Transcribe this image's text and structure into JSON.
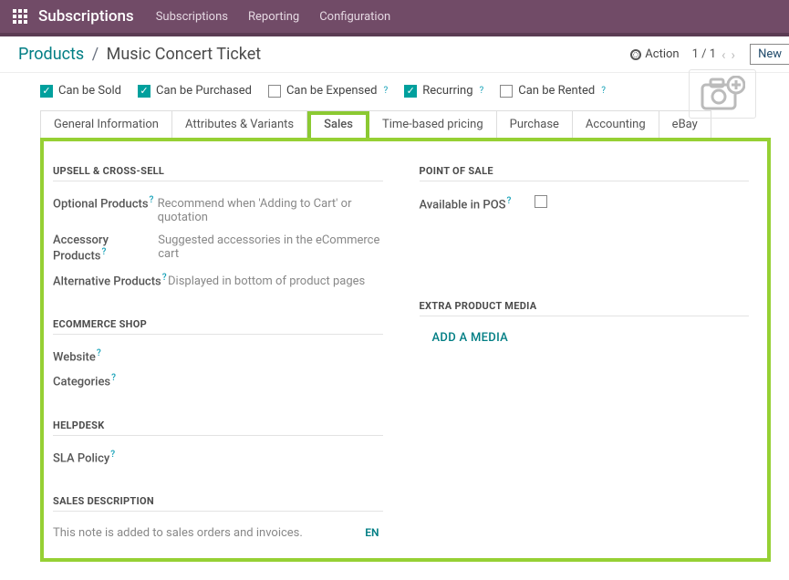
{
  "topbar": {
    "brand": "Subscriptions",
    "nav": {
      "subscriptions": "Subscriptions",
      "reporting": "Reporting",
      "configuration": "Configuration"
    }
  },
  "breadcrumb": {
    "root": "Products",
    "sep": "/",
    "current": "Music Concert Ticket"
  },
  "subbar": {
    "action": "Action",
    "pager": "1 / 1",
    "new": "New"
  },
  "checks": {
    "sold": "Can be Sold",
    "purchased": "Can be Purchased",
    "expensed": "Can be Expensed",
    "recurring": "Recurring",
    "rented": "Can be Rented"
  },
  "tabs": {
    "general": "General Information",
    "attrs": "Attributes & Variants",
    "sales": "Sales",
    "pricing": "Time-based pricing",
    "purchase": "Purchase",
    "accounting": "Accounting",
    "ebay": "eBay"
  },
  "sales": {
    "upsell_title": "UPSELL & CROSS-SELL",
    "optional": "Optional Products",
    "optional_hint": "Recommend when 'Adding to Cart' or quotation",
    "accessory": "Accessory Products",
    "accessory_hint": "Suggested accessories in the eCommerce cart",
    "alternative": "Alternative Products",
    "alternative_hint": "Displayed in bottom of product pages",
    "ecom_title": "ECOMMERCE SHOP",
    "website": "Website",
    "categories": "Categories",
    "helpdesk_title": "HELPDESK",
    "sla": "SLA Policy",
    "salesdesc_title": "SALES DESCRIPTION",
    "salesdesc_hint": "This note is added to sales orders and invoices.",
    "lang": "EN",
    "pos_title": "POINT OF SALE",
    "pos_available": "Available in POS",
    "extra_media_title": "EXTRA PRODUCT MEDIA",
    "add_media": "ADD A MEDIA"
  }
}
